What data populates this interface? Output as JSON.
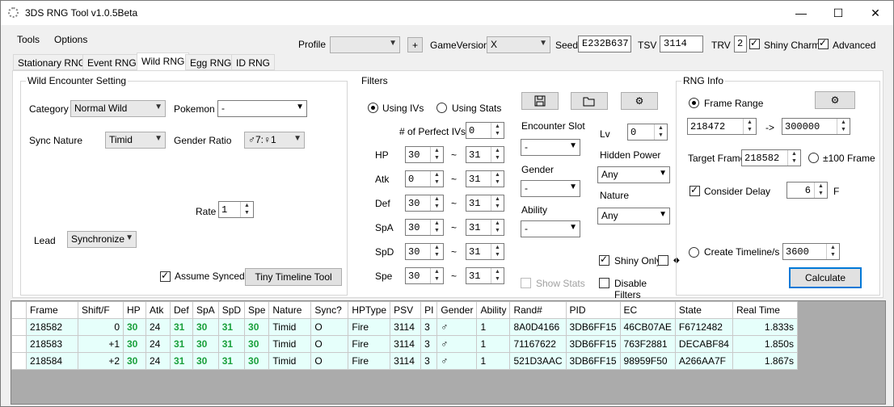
{
  "app": {
    "title": "3DS RNG Tool v1.0.5Beta"
  },
  "menu": [
    "Tools",
    "Options"
  ],
  "toolbar": {
    "profile_label": "Profile",
    "profile_value": "",
    "add_label": "+",
    "gameversion_label": "GameVersion",
    "gameversion_value": "X",
    "seed_label": "Seed",
    "seed_value": "E232B637",
    "tsv_label": "TSV",
    "tsv_value": "3114",
    "trv_label": "TRV",
    "trv_value": "2",
    "shiny_charm_label": "Shiny Charm",
    "advanced_label": "Advanced"
  },
  "tabs": [
    "Stationary RNG",
    "Event RNG",
    "Wild RNG",
    "Egg RNG",
    "ID RNG"
  ],
  "wild": {
    "title": "Wild Encounter Setting",
    "category_label": "Category",
    "category_value": "Normal Wild",
    "pokemon_label": "Pokemon",
    "pokemon_value": "-",
    "sync_nature_label": "Sync Nature",
    "sync_nature_value": "Timid",
    "gender_ratio_label": "Gender Ratio",
    "gender_ratio_value": "♂7:♀1",
    "rate_label": "Rate",
    "rate_value": "1",
    "lead_label": "Lead",
    "lead_value": "Synchronize",
    "assume_synced_label": "Assume Synced",
    "tiny_timeline_label": "Tiny Timeline Tool"
  },
  "filters": {
    "title": "Filters",
    "using_ivs": "Using IVs",
    "using_stats": "Using Stats",
    "perfect_ivs_label": "# of Perfect IVs",
    "perfect_ivs_value": "0",
    "tilde": "~",
    "ivs": [
      {
        "stat": "HP",
        "min": "30",
        "max": "31"
      },
      {
        "stat": "Atk",
        "min": "0",
        "max": "31"
      },
      {
        "stat": "Def",
        "min": "30",
        "max": "31"
      },
      {
        "stat": "SpA",
        "min": "30",
        "max": "31"
      },
      {
        "stat": "SpD",
        "min": "30",
        "max": "31"
      },
      {
        "stat": "Spe",
        "min": "30",
        "max": "31"
      }
    ],
    "encounter_slot_label": "Encounter Slot",
    "encounter_slot_value": "-",
    "gender_label": "Gender",
    "gender_value": "-",
    "ability_label": "Ability",
    "ability_value": "-",
    "lv_label": "Lv",
    "lv_value": "0",
    "hidden_power_label": "Hidden Power",
    "hidden_power_value": "Any",
    "nature_label": "Nature",
    "nature_value": "Any",
    "shiny_only_label": "Shiny Only",
    "diamond": "◆",
    "show_stats_label": "Show Stats",
    "disable_filters_label": "Disable Filters"
  },
  "rnginfo": {
    "title": "RNG Info",
    "frame_range_label": "Frame Range",
    "range_start": "218472",
    "range_arrow": "->",
    "range_end": "300000",
    "target_frame_label": "Target Frame",
    "target_frame_value": "218582",
    "pm100_label": "±100 Frame",
    "consider_delay_label": "Consider Delay",
    "delay_value": "6",
    "delay_unit": "F",
    "create_timeline_label": "Create Timeline/s",
    "timeline_value": "3600",
    "calculate_label": "Calculate"
  },
  "results": {
    "headers": [
      "Frame",
      "Shift/F",
      "HP",
      "Atk",
      "Def",
      "SpA",
      "SpD",
      "Spe",
      "Nature",
      "Sync?",
      "HPType",
      "PSV",
      "PI",
      "Gender",
      "Ability",
      "Rand#",
      "PID",
      "EC",
      "State",
      "Real Time"
    ],
    "rows": [
      [
        "218582",
        "0",
        "30",
        "24",
        "31",
        "30",
        "31",
        "30",
        "Timid",
        "O",
        "Fire",
        "3114",
        "3",
        "♂",
        "1",
        "8A0D4166",
        "3DB6FF15",
        "46CB07AE",
        "F6712482",
        "1.833s"
      ],
      [
        "218583",
        "+1",
        "30",
        "24",
        "31",
        "30",
        "31",
        "30",
        "Timid",
        "O",
        "Fire",
        "3114",
        "3",
        "♂",
        "1",
        "71167622",
        "3DB6FF15",
        "763F2881",
        "DECABF84",
        "1.850s"
      ],
      [
        "218584",
        "+2",
        "30",
        "24",
        "31",
        "30",
        "31",
        "30",
        "Timid",
        "O",
        "Fire",
        "3114",
        "3",
        "♂",
        "1",
        "521D3AAC",
        "3DB6FF15",
        "98959F50",
        "A266AA7F",
        "1.867s"
      ]
    ]
  }
}
